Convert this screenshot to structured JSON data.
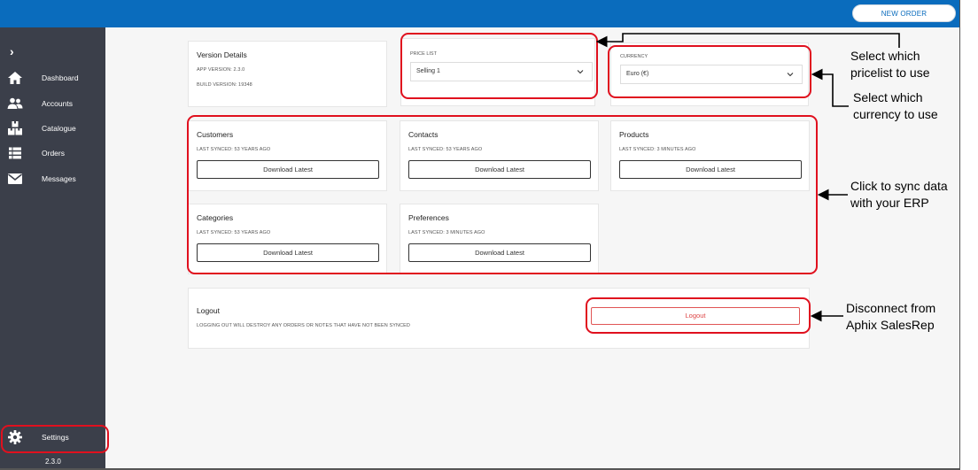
{
  "topbar": {
    "new_order_label": "NEW ORDER"
  },
  "sidebar": {
    "items": [
      {
        "label": "Dashboard",
        "icon": "home-icon"
      },
      {
        "label": "Accounts",
        "icon": "users-icon"
      },
      {
        "label": "Catalogue",
        "icon": "boxes-icon"
      },
      {
        "label": "Orders",
        "icon": "list-icon"
      },
      {
        "label": "Messages",
        "icon": "envelope-icon"
      }
    ],
    "settings": {
      "label": "Settings",
      "icon": "gear-icon"
    },
    "version": "2.3.0"
  },
  "version_details": {
    "title": "Version Details",
    "app_version": "APP VERSION: 2.3.0",
    "build_version": "BUILD VERSION: 19348"
  },
  "price_list": {
    "caption": "PRICE LIST",
    "value": "Selling 1"
  },
  "currency": {
    "caption": "CURRENCY",
    "value": "Euro (€)"
  },
  "sync_cards": [
    {
      "title": "Customers",
      "last_synced": "LAST SYNCED: 53 YEARS AGO",
      "button": "Download Latest"
    },
    {
      "title": "Contacts",
      "last_synced": "LAST SYNCED: 53 YEARS AGO",
      "button": "Download Latest"
    },
    {
      "title": "Products",
      "last_synced": "LAST SYNCED: 3 MINUTES AGO",
      "button": "Download Latest"
    },
    {
      "title": "Categories",
      "last_synced": "LAST SYNCED: 53 YEARS AGO",
      "button": "Download Latest"
    },
    {
      "title": "Preferences",
      "last_synced": "LAST SYNCED: 3 MINUTES AGO",
      "button": "Download Latest"
    }
  ],
  "logout": {
    "title": "Logout",
    "warning": "LOGGING OUT WILL DESTROY ANY ORDERS OR NOTES THAT HAVE NOT BEEN SYNCED",
    "button": "Logout"
  },
  "annotations": {
    "pricelist": [
      "Select which",
      "pricelist to use"
    ],
    "currency": [
      "Select which",
      "currency to use"
    ],
    "sync": [
      "Click to sync data",
      "with your ERP"
    ],
    "disconnect": [
      "Disconnect from",
      "Aphix SalesRep"
    ]
  },
  "colors": {
    "brand_blue": "#0a6cbd",
    "sidebar_bg": "#3b3f4a",
    "highlight_red": "#e0101e"
  }
}
